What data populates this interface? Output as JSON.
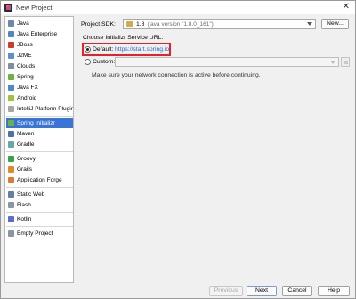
{
  "window": {
    "title": "New Project",
    "close_glyph": "✕"
  },
  "sidebar": {
    "items": [
      {
        "label": "Java",
        "icon": "java-icon",
        "color": "#6b86b0"
      },
      {
        "label": "Java Enterprise",
        "icon": "java-enterprise-icon",
        "color": "#4f88c7"
      },
      {
        "label": "JBoss",
        "icon": "jboss-icon",
        "color": "#cf3a2c"
      },
      {
        "label": "J2ME",
        "icon": "j2me-icon",
        "color": "#5a8fd0"
      },
      {
        "label": "Clouds",
        "icon": "clouds-icon",
        "color": "#7a8ea5"
      },
      {
        "label": "Spring",
        "icon": "spring-icon",
        "color": "#6db33f"
      },
      {
        "label": "Java FX",
        "icon": "javafx-icon",
        "color": "#4b8ad1"
      },
      {
        "label": "Android",
        "icon": "android-icon",
        "color": "#9cc33a"
      },
      {
        "label": "IntelliJ Platform Plugin",
        "icon": "intellij-plugin-icon",
        "color": "#a7a7a7"
      },
      {
        "label": "Spring Initializr",
        "icon": "spring-initializr-icon",
        "color": "#6db33f",
        "selected": true
      },
      {
        "label": "Maven",
        "icon": "maven-icon",
        "color": "#4f6fb0"
      },
      {
        "label": "Gradle",
        "icon": "gradle-icon",
        "color": "#6aa5a8"
      },
      {
        "label": "Groovy",
        "icon": "groovy-icon",
        "color": "#3aa34a"
      },
      {
        "label": "Grails",
        "icon": "grails-icon",
        "color": "#e08a2c"
      },
      {
        "label": "Application Forge",
        "icon": "application-forge-icon",
        "color": "#e07a2c"
      },
      {
        "label": "Static Web",
        "icon": "static-web-icon",
        "color": "#5f7fa8"
      },
      {
        "label": "Flash",
        "icon": "flash-icon",
        "color": "#8b96a4"
      },
      {
        "label": "Kotlin",
        "icon": "kotlin-icon",
        "color": "#5b6cd6"
      },
      {
        "label": "Empty Project",
        "icon": "empty-project-icon",
        "color": "#8a95a3"
      }
    ]
  },
  "main": {
    "sdk_label": "Project SDK:",
    "sdk_value": "1.8",
    "sdk_detail": "(java version \"1.8.0_161\")",
    "new_button": "New...",
    "choose_label": "Choose Initializr Service URL.",
    "default_label": "Default:",
    "default_url": "https://start.spring.io",
    "custom_label": "Custom:",
    "note": "Make sure your network connection is active before continuing."
  },
  "footer": {
    "previous": "Previous",
    "next": "Next",
    "cancel": "Cancel",
    "help": "Help"
  },
  "colors": {
    "selection": "#3875d7",
    "highlight_box": "#e8202a",
    "link": "#2a6bd1"
  }
}
